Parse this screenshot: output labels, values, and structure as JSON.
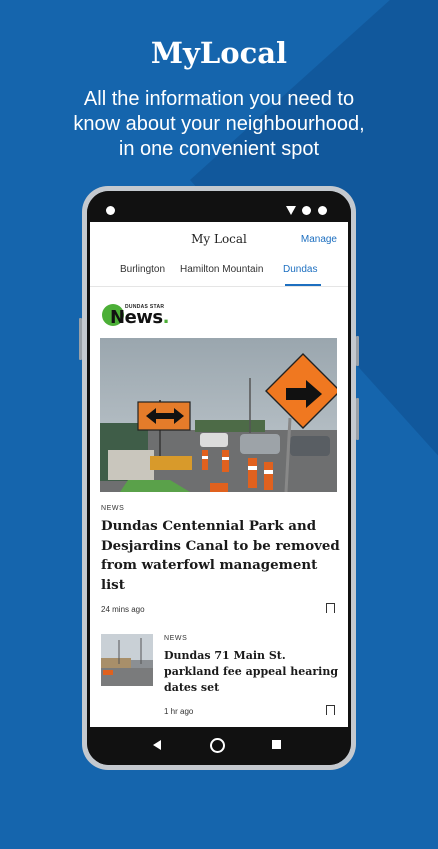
{
  "promo": {
    "title": "MyLocal",
    "subtitle_lines": [
      "All the information you need to",
      "know about your neighbourhood,",
      "in one convenient spot"
    ]
  },
  "app": {
    "title": "My Local",
    "manage_label": "Manage",
    "tabs": [
      {
        "label": "Burlington",
        "active": false
      },
      {
        "label": "Hamilton Mountain",
        "active": false
      },
      {
        "label": "Dundas",
        "active": true
      }
    ],
    "logo": {
      "small_text": "DUNDAS STAR",
      "brand_text": "News",
      "brand_dot": "."
    }
  },
  "articles": [
    {
      "kicker": "NEWS",
      "headline": "Dundas Centennial Park and Desjardins Canal to be removed from waterfowl management list",
      "time": "24 mins ago",
      "image": "road-construction-signs-photo"
    },
    {
      "kicker": "NEWS",
      "headline": "Dundas 71 Main St. parkland fee appeal hearing dates set",
      "time": "1 hr ago",
      "image": "construction-site-thumbnail"
    }
  ],
  "icons": {
    "bookmark": "bookmark-icon",
    "back": "back-icon",
    "home": "home-icon",
    "recents": "recents-icon"
  },
  "colors": {
    "background": "#1565ad",
    "accent": "#1d6fc0",
    "brand_green": "#4caf37"
  }
}
